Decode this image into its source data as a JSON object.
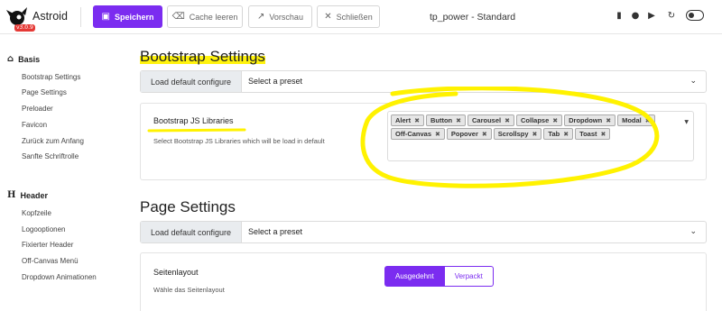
{
  "app": {
    "brand": "Astroid",
    "version": "v3.0.9",
    "doc_title": "tp_power - Standard"
  },
  "toolbar": {
    "save_label": "Speichern",
    "clear_cache_label": "Cache leeren",
    "preview_label": "Vorschau",
    "close_label": "Schließen",
    "icons": [
      "book-icon",
      "github-icon",
      "youtube-icon",
      "refresh-icon",
      "dark-mode-toggle"
    ]
  },
  "sidebar": {
    "sections": [
      {
        "title": "Basis",
        "icon": "home-icon",
        "items": [
          "Bootstrap Settings",
          "Page Settings",
          "Preloader",
          "Favicon",
          "Zurück zum Anfang",
          "Sanfte Schriftrolle"
        ]
      },
      {
        "title": "Header",
        "icon": "header-icon",
        "items": [
          "Kopfzeile",
          "Logooptionen",
          "Fixierter Header",
          "Off-Canvas Menü",
          "Dropdown Animationen"
        ]
      }
    ]
  },
  "main": {
    "bootstrap": {
      "title": "Bootstrap Settings",
      "preset_button": "Load default configure",
      "preset_select": "Select a preset",
      "libraries": {
        "label": "Bootstrap JS Libraries",
        "description": "Select Bootstrap JS Libraries which will be load in default",
        "tags": [
          "Alert",
          "Button",
          "Carousel",
          "Collapse",
          "Dropdown",
          "Modal",
          "Off-Canvas",
          "Popover",
          "Scrollspy",
          "Tab",
          "Toast"
        ]
      }
    },
    "page": {
      "title": "Page Settings",
      "preset_button": "Load default configure",
      "preset_select": "Select a preset",
      "layout": {
        "label": "Seitenlayout",
        "description": "Wähle das Seitenlayout",
        "options": [
          "Ausgedehnt",
          "Verpackt"
        ],
        "selected": "Ausgedehnt"
      }
    }
  },
  "colors": {
    "accent": "#7b2cf0",
    "highlight": "#fff200"
  }
}
